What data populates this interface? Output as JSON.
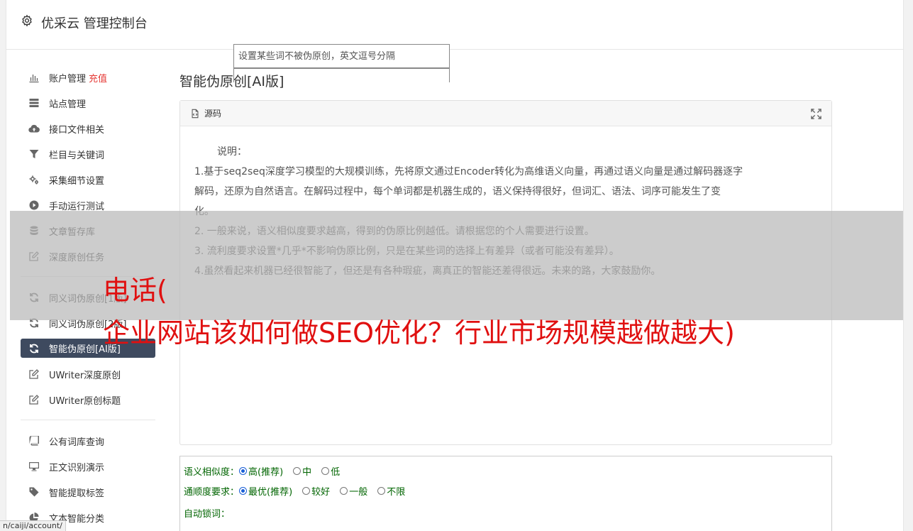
{
  "app": {
    "title": "优采云 管理控制台"
  },
  "sidebar": {
    "group1": [
      {
        "label": "账户管理",
        "accent": "充值",
        "icon": "bar-chart-icon"
      },
      {
        "label": "站点管理",
        "icon": "server-icon"
      },
      {
        "label": "接口文件相关",
        "icon": "cloud-upload-icon"
      },
      {
        "label": "栏目与关键词",
        "icon": "filter-icon"
      },
      {
        "label": "采集细节设置",
        "icon": "cogs-icon"
      },
      {
        "label": "手动运行测试",
        "icon": "play-circle-icon"
      },
      {
        "label": "文章暂存库",
        "icon": "database-icon"
      },
      {
        "label": "深度原创任务",
        "icon": "edit-icon"
      }
    ],
    "group2": [
      {
        "label": "同义词伪原创[1版]",
        "icon": "refresh-icon"
      },
      {
        "label": "同义词伪原创[2版]",
        "icon": "refresh-icon"
      },
      {
        "label": "智能伪原创[AI版]",
        "icon": "refresh-icon",
        "active": true
      },
      {
        "label": "UWriter深度原创",
        "icon": "edit-icon"
      },
      {
        "label": "UWriter原创标题",
        "icon": "edit-icon"
      }
    ],
    "group3": [
      {
        "label": "公有词库查询",
        "icon": "book-icon"
      },
      {
        "label": "正文识别演示",
        "icon": "monitor-icon"
      },
      {
        "label": "智能提取标签",
        "icon": "tag-icon"
      },
      {
        "label": "文本智能分类",
        "icon": "pie-chart-icon"
      }
    ]
  },
  "main": {
    "title": "智能伪原创[AI版]",
    "panel_label": "源码",
    "description": {
      "heading": "说明：",
      "lines": [
        "1.基于seq2seq深度学习模型的大规模训练，先将原文通过Encoder转化为高维语义向量，再通过语义向量是通过解码器逐字",
        "解码，还原为自然语言。在解码过程中，每个单词都是机器生成的，语义保持得很好，但词汇、语法、词序可能发生了变",
        "化。",
        "2. 一般来说，语义相似度要求越高，得到的伪原比例越低。请根据您的个人需要进行设置。",
        "3. 流利度要求设置*几乎*不影响伪原比例，只是在某些词的选择上有差异（或者可能没有差异）。",
        "4.虽然看起来机器已经很智能了，但还是有各种瑕疵，离真正的智能还差得很远。未来的路，大家鼓励你。"
      ]
    }
  },
  "form": {
    "similarity": {
      "label": "语义相似度：",
      "options": [
        "高(推荐)",
        "中",
        "低"
      ],
      "selected": "高(推荐)"
    },
    "fluency": {
      "label": "通顺度要求：",
      "options": [
        "最优(推荐)",
        "较好",
        "一般",
        "不限"
      ],
      "selected": "最优(推荐)"
    },
    "lock": {
      "label": "自动锁词：",
      "placeholder": "设置某些词不被伪原创，英文逗号分隔"
    }
  },
  "watermark": {
    "line1": "电话(",
    "line2": "企业网站该如何做SEO优化？行业市场规模越做越大)"
  },
  "status_url": "n/caiji/account/"
}
